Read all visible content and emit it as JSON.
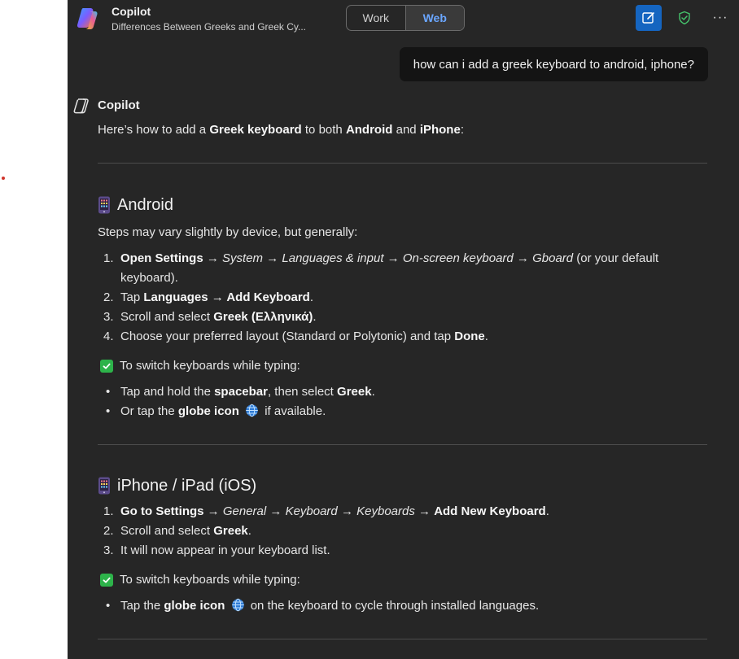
{
  "header": {
    "app_title": "Copilot",
    "conversation_title": "Differences Between Greeks and Greek Cy...",
    "toggle": {
      "work_label": "Work",
      "web_label": "Web",
      "selected": "Web"
    },
    "icons": {
      "new_chat": "new-chat-icon",
      "shield": "shield-check-icon",
      "more": "more-options-icon"
    },
    "more_label": "···"
  },
  "user_message": "how can i add a greek keyboard to android, iphone?",
  "bot": {
    "name": "Copilot",
    "intro": {
      "p1": "Here’s how to add a ",
      "b1": "Greek keyboard",
      "p2": " to both ",
      "b2": "Android",
      "p3": " and ",
      "b3": "iPhone",
      "p4": ":"
    },
    "android": {
      "heading": "Android",
      "subtext": "Steps may vary slightly by device, but generally:",
      "steps": [
        {
          "num": "1.",
          "b1": "Open Settings",
          "a1": " → ",
          "i1": "System",
          "a2": " → ",
          "i2": "Languages & input",
          "a3": " → ",
          "i3": "On-screen keyboard",
          "a4": " → ",
          "i4": "Gboard",
          "tail": " (or your default keyboard)."
        },
        {
          "num": "2.",
          "p1": "Tap ",
          "b1": "Languages",
          "a1": " → ",
          "b2": "Add Keyboard",
          "tail": "."
        },
        {
          "num": "3.",
          "p1": "Scroll and select ",
          "b1": "Greek (Ελληνικά)",
          "tail": "."
        },
        {
          "num": "4.",
          "p1": "Choose your preferred layout (Standard or Polytonic) and tap ",
          "b1": "Done",
          "tail": "."
        }
      ],
      "switch_label": "To switch keyboards while typing:",
      "bullets": [
        {
          "p1": "Tap and hold the ",
          "b1": "spacebar",
          "p2": ", then select ",
          "b2": "Greek",
          "tail": "."
        },
        {
          "p1": "Or tap the ",
          "b1": "globe icon",
          "tail": " if available."
        }
      ]
    },
    "ios": {
      "heading": "iPhone / iPad (iOS)",
      "steps": [
        {
          "num": "1.",
          "b1": "Go to Settings",
          "a1": " → ",
          "i1": "General",
          "a2": " → ",
          "i2": "Keyboard",
          "a3": " → ",
          "i3": "Keyboards",
          "a4": " → ",
          "b2": "Add New Keyboard",
          "tail": "."
        },
        {
          "num": "2.",
          "p1": "Scroll and select ",
          "b1": "Greek",
          "tail": "."
        },
        {
          "num": "3.",
          "p1": "It will now appear in your keyboard list."
        }
      ],
      "switch_label": "To switch keyboards while typing:",
      "bullets": [
        {
          "p1": "Tap the ",
          "b1": "globe icon",
          "tail": " on the keyboard to cycle through installed languages."
        }
      ]
    },
    "bullet_char": "•"
  },
  "colors": {
    "panel_bg": "#262626",
    "accent_blue": "#1565c0",
    "web_text": "#6aa6ff",
    "check_green": "#2db34a",
    "user_bubble": "#141414"
  }
}
